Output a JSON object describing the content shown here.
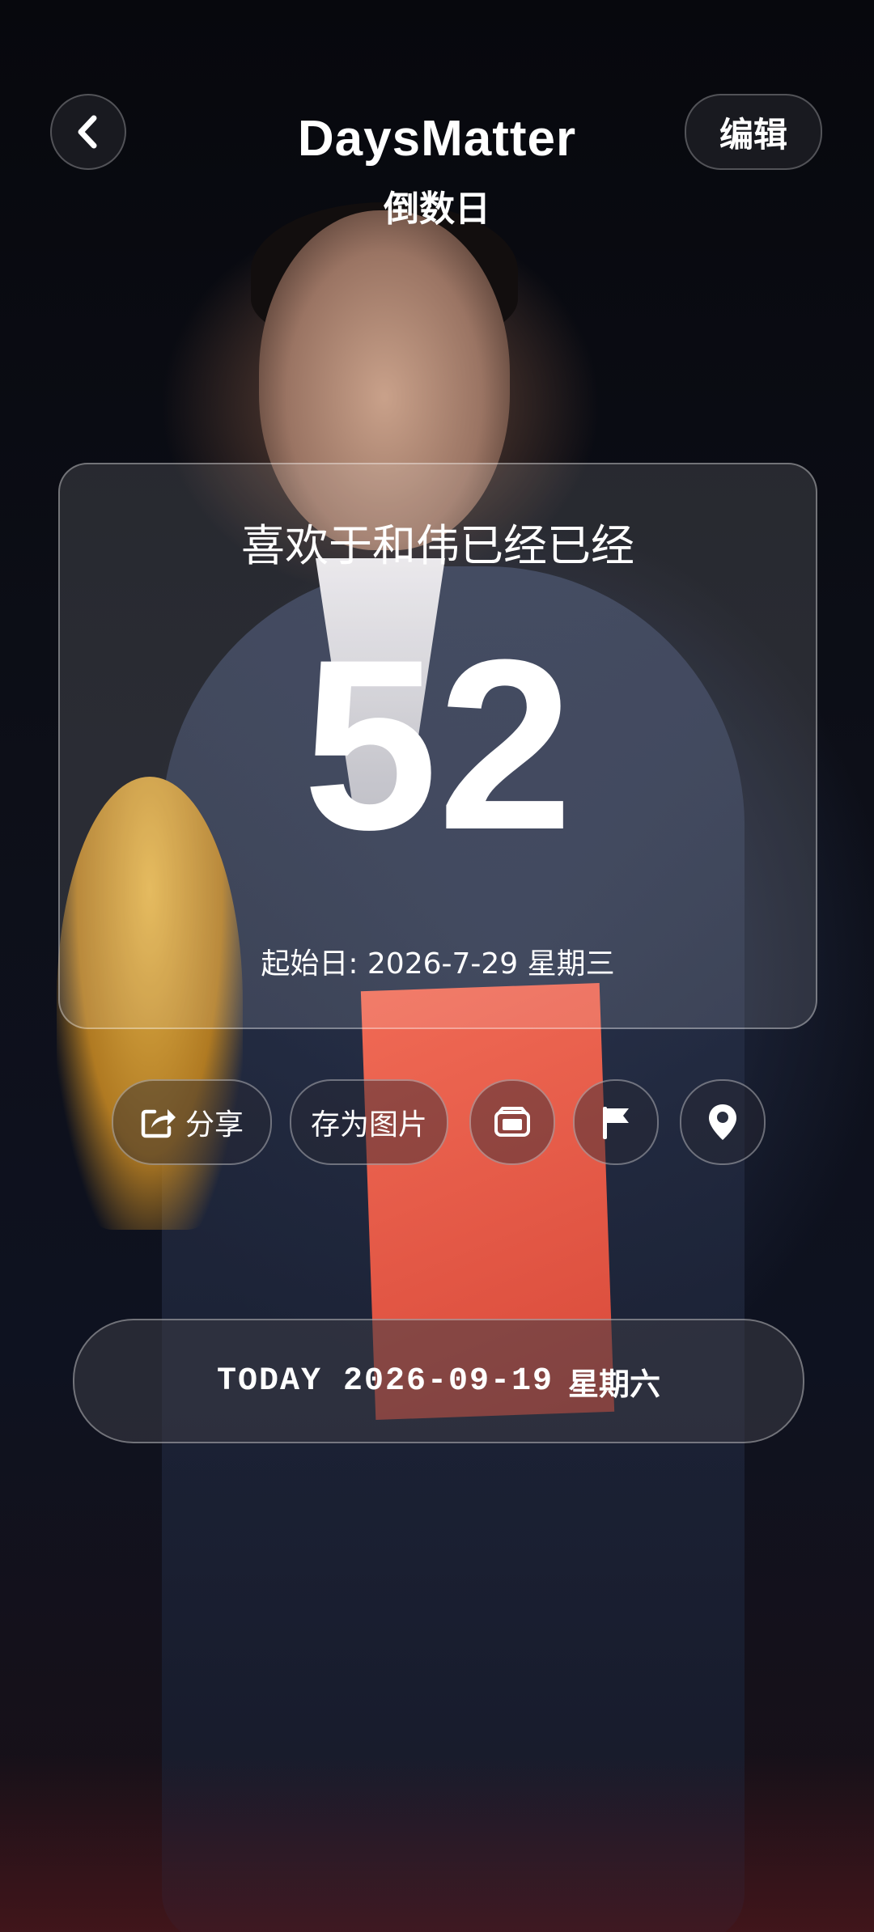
{
  "header": {
    "title": "DaysMatter",
    "subtitle": "倒数日",
    "edit_label": "编辑"
  },
  "card": {
    "title": "喜欢于和伟已经已经",
    "days": "52",
    "start_date": "起始日: 2026-7-29 星期三"
  },
  "actions": {
    "share_label": "分享",
    "save_image_label": "存为图片",
    "icons": [
      "share-icon",
      "photo-icon",
      "flag-icon",
      "location-pin-icon"
    ]
  },
  "today": {
    "date_text": "TODAY 2026-09-19",
    "weekday": "星期六"
  },
  "colors": {
    "text": "#ffffff",
    "glass": "rgba(255,255,255,0.12)"
  }
}
